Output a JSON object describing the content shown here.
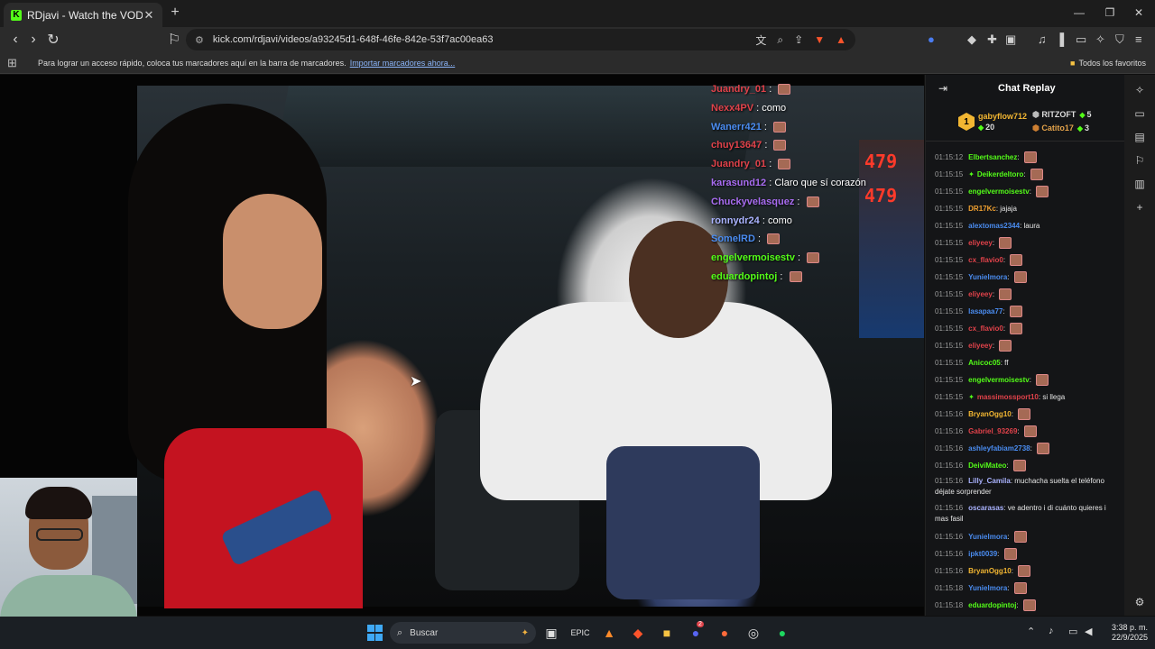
{
  "browser": {
    "tab_title": "RDjavi - Watch the VOD on K",
    "url": "kick.com/rdjavi/videos/a93245d1-648f-46fe-842e-53f7ac00ea63",
    "bookmarks_message": "Para lograr un acceso rápido, coloca tus marcadores aquí en la barra de marcadores.",
    "bookmarks_link": "Importar marcadores ahora...",
    "all_favorites": "Todos los favoritos",
    "shield_count": "2"
  },
  "video": {
    "gas_price_1": "479",
    "gas_price_2": "479",
    "overlay_chat": [
      {
        "user": "Juandry_01",
        "msg": "",
        "color": "#e0424a",
        "emote": true
      },
      {
        "user": "Nexx4PV",
        "msg": "como",
        "color": "#e0424a",
        "emote": false
      },
      {
        "user": "Wanerr421",
        "msg": "",
        "color": "#4a8cf0",
        "emote": true
      },
      {
        "user": "chuy13647",
        "msg": "",
        "color": "#e0424a",
        "emote": true
      },
      {
        "user": "Juandry_01",
        "msg": "",
        "color": "#e0424a",
        "emote": true
      },
      {
        "user": "karasund12",
        "msg": "Claro que sí corazón",
        "color": "#a86cf0",
        "emote": false
      },
      {
        "user": "Chuckyvelasquez",
        "msg": "",
        "color": "#a86cf0",
        "emote": true
      },
      {
        "user": "ronnydr24",
        "msg": "como",
        "color": "#aab3ff",
        "emote": false
      },
      {
        "user": "SomelRD",
        "msg": "",
        "color": "#4a8cf0",
        "emote": true
      },
      {
        "user": "engelvermoisestv",
        "msg": "",
        "color": "#53fc18",
        "emote": true
      },
      {
        "user": "eduardopintoj",
        "msg": "",
        "color": "#53fc18",
        "emote": true
      }
    ]
  },
  "chat": {
    "title": "Chat Replay",
    "leaderboard": {
      "first": {
        "rank": "1",
        "name": "gabyflow712",
        "count": "20"
      },
      "second": {
        "name": "RITZOFT",
        "count": "5"
      },
      "third": {
        "name": "Catito17",
        "count": "3"
      }
    },
    "messages": [
      {
        "ts": "01:15:12",
        "user": "Elbertsanchez",
        "color": "#53fc18",
        "text": "",
        "emote": true,
        "sub": false
      },
      {
        "ts": "01:15:15",
        "user": "Deikerdeltoro",
        "color": "#53fc18",
        "text": "",
        "emote": true,
        "sub": true
      },
      {
        "ts": "01:15:15",
        "user": "engelvermoisestv",
        "color": "#53fc18",
        "text": "",
        "emote": true,
        "sub": false
      },
      {
        "ts": "01:15:15",
        "user": "DR17Kc",
        "color": "#f0a030",
        "text": "jajaja",
        "emote": false,
        "sub": false
      },
      {
        "ts": "01:15:15",
        "user": "alextomas2344",
        "color": "#4a8cf0",
        "text": "laura",
        "emote": false,
        "sub": false
      },
      {
        "ts": "01:15:15",
        "user": "eliyeey",
        "color": "#e0424a",
        "text": "",
        "emote": true,
        "sub": false
      },
      {
        "ts": "01:15:15",
        "user": "cx_flavio0",
        "color": "#e0424a",
        "text": "",
        "emote": true,
        "sub": false
      },
      {
        "ts": "01:15:15",
        "user": "Yunielmora",
        "color": "#4a8cf0",
        "text": "",
        "emote": true,
        "sub": false
      },
      {
        "ts": "01:15:15",
        "user": "eliyeey",
        "color": "#e0424a",
        "text": "",
        "emote": true,
        "sub": false
      },
      {
        "ts": "01:15:15",
        "user": "lasapaa77",
        "color": "#4a8cf0",
        "text": "",
        "emote": true,
        "sub": false
      },
      {
        "ts": "01:15:15",
        "user": "cx_flavio0",
        "color": "#e0424a",
        "text": "",
        "emote": true,
        "sub": false
      },
      {
        "ts": "01:15:15",
        "user": "eliyeey",
        "color": "#e0424a",
        "text": "",
        "emote": true,
        "sub": false
      },
      {
        "ts": "01:15:15",
        "user": "Anicoc05",
        "color": "#53fc18",
        "text": "ff",
        "emote": false,
        "sub": false
      },
      {
        "ts": "01:15:15",
        "user": "engelvermoisestv",
        "color": "#53fc18",
        "text": "",
        "emote": true,
        "sub": false
      },
      {
        "ts": "01:15:15",
        "user": "massimossport10",
        "color": "#e0424a",
        "text": "si llega",
        "emote": false,
        "sub": true
      },
      {
        "ts": "01:15:16",
        "user": "BryanOgg10",
        "color": "#f2b632",
        "text": "",
        "emote": true,
        "sub": false
      },
      {
        "ts": "01:15:16",
        "user": "Gabriel_93269",
        "color": "#e0424a",
        "text": "",
        "emote": true,
        "sub": false
      },
      {
        "ts": "01:15:16",
        "user": "ashleyfabiam2738",
        "color": "#4a8cf0",
        "text": "",
        "emote": true,
        "sub": false
      },
      {
        "ts": "01:15:16",
        "user": "DeiviMateo",
        "color": "#53fc18",
        "text": "",
        "emote": true,
        "sub": false
      },
      {
        "ts": "01:15:16",
        "user": "Lilly_Camila",
        "color": "#aab3ff",
        "text": "muchacha suelta el teléfono déjate sorprender",
        "emote": false,
        "sub": false,
        "tall": true
      },
      {
        "ts": "01:15:16",
        "user": "oscarasas",
        "color": "#aab3ff",
        "text": "ve adentro i di cuánto quieres i mas fasil",
        "emote": false,
        "sub": false,
        "tall": true
      },
      {
        "ts": "01:15:16",
        "user": "Yunielmora",
        "color": "#4a8cf0",
        "text": "",
        "emote": true,
        "sub": false
      },
      {
        "ts": "01:15:16",
        "user": "ipkt0039",
        "color": "#4a8cf0",
        "text": "",
        "emote": true,
        "sub": false
      },
      {
        "ts": "01:15:16",
        "user": "BryanOgg10",
        "color": "#f2b632",
        "text": "",
        "emote": true,
        "sub": false
      },
      {
        "ts": "01:15:18",
        "user": "Yunielmora",
        "color": "#4a8cf0",
        "text": "",
        "emote": true,
        "sub": false
      },
      {
        "ts": "01:15:18",
        "user": "eduardopintoj",
        "color": "#53fc18",
        "text": "",
        "emote": true,
        "sub": false
      }
    ]
  },
  "taskbar": {
    "search_placeholder": "Buscar",
    "time": "3:38 p. m.",
    "date": "22/9/2025",
    "discord_badge": "2"
  }
}
